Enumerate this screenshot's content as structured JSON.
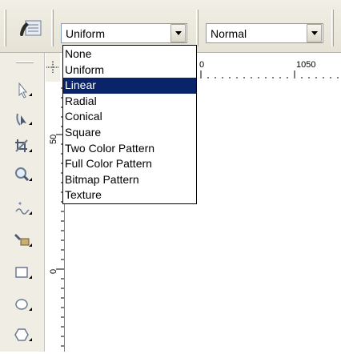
{
  "toolbar": {
    "fill_type": {
      "value": "Uniform",
      "options": [
        "None",
        "Uniform",
        "Linear",
        "Radial",
        "Conical",
        "Square",
        "Two Color Pattern",
        "Full Color Pattern",
        "Bitmap Pattern",
        "Texture"
      ],
      "highlighted": "Linear"
    },
    "merge_mode": {
      "value": "Normal"
    }
  },
  "rulers": {
    "horizontal_labels": [
      "0",
      "1050"
    ],
    "vertical_labels": [
      "50",
      "0"
    ]
  },
  "toolbox": {
    "tools": [
      "pick-tool-icon",
      "shape-tool-icon",
      "crop-tool-icon",
      "zoom-tool-icon",
      "freehand-tool-icon",
      "smart-fill-tool-icon",
      "rectangle-tool-icon",
      "ellipse-tool-icon",
      "polygon-tool-icon"
    ]
  },
  "colors": {
    "selection": "#0a246a",
    "toolbar_bg": "#ece9d8"
  }
}
